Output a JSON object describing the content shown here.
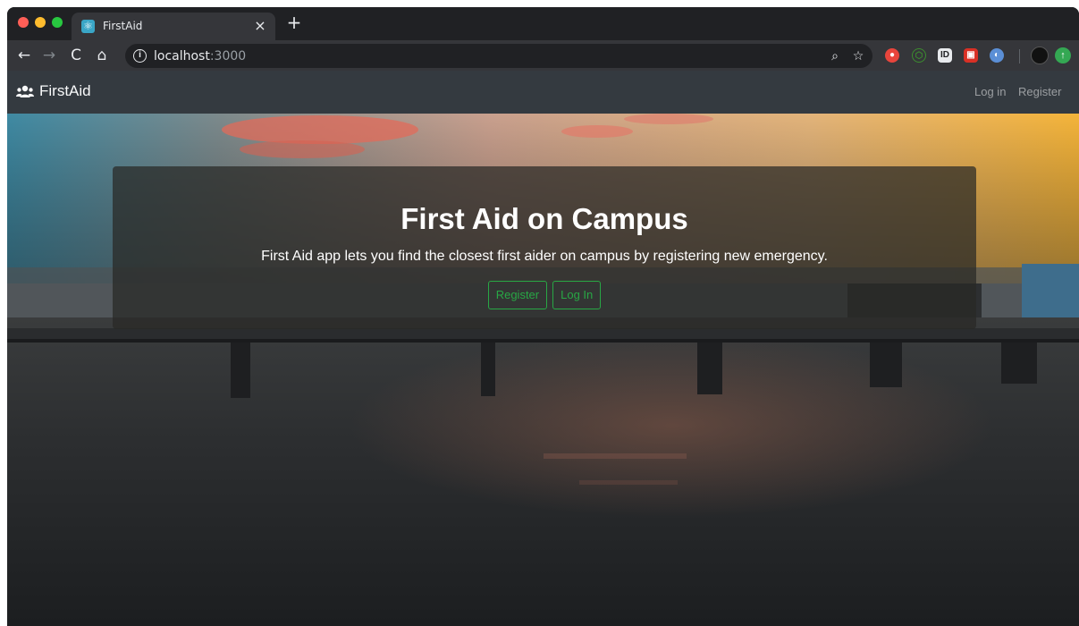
{
  "browser": {
    "tab": {
      "title": "FirstAid",
      "close_glyph": "×",
      "favicon": "react-atom-icon"
    },
    "new_tab_glyph": "+",
    "nav": {
      "back": "←",
      "forward": "→",
      "reload": "C",
      "home": "⌂"
    },
    "address": {
      "info_glyph": "i",
      "host": "localhost",
      "port": ":3000"
    },
    "omnibox_icons": {
      "zoom": "⌕",
      "bookmark": "☆"
    },
    "extensions": [
      "ublock-icon",
      "node-icon",
      "id-icon",
      "ext-red-icon",
      "ext-blue-icon"
    ]
  },
  "navbar": {
    "brand": "FirstAid",
    "brand_icon": "users-icon",
    "links": {
      "login": "Log in",
      "register": "Register"
    },
    "background": "#343a40"
  },
  "hero": {
    "title": "First Aid on Campus",
    "lead": "First Aid app lets you find the closest first aider on campus by registering new emergency.",
    "buttons": {
      "register": "Register",
      "login": "Log In"
    },
    "accent": "#28a745"
  }
}
